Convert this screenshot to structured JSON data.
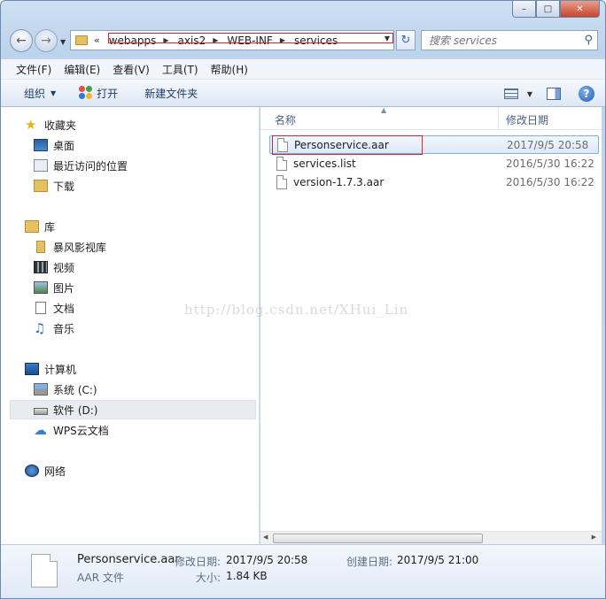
{
  "window": {
    "caption_buttons": {
      "minimize": "–",
      "maximize": "□",
      "close": "✕"
    }
  },
  "navigation": {
    "back_icon": "back-arrow-icon",
    "forward_icon": "forward-arrow-icon",
    "address": {
      "overflow": "«",
      "crumbs": [
        "webapps",
        "axis2",
        "WEB-INF",
        "services"
      ]
    },
    "search_placeholder": "搜索 services"
  },
  "menu": [
    "文件(F)",
    "编辑(E)",
    "查看(V)",
    "工具(T)",
    "帮助(H)"
  ],
  "toolbar": {
    "organize": "组织",
    "open": "打开",
    "new_folder": "新建文件夹",
    "help": "?"
  },
  "sidebar": {
    "favorites": {
      "label": "收藏夹",
      "items": [
        "桌面",
        "最近访问的位置",
        "下载"
      ]
    },
    "libraries": {
      "label": "库",
      "items": [
        "暴风影视库",
        "视频",
        "图片",
        "文档",
        "音乐"
      ]
    },
    "computer": {
      "label": "计算机",
      "items": [
        "系统 (C:)",
        "软件 (D:)",
        "WPS云文档"
      ]
    },
    "network": {
      "label": "网络"
    }
  },
  "columns": {
    "name": "名称",
    "modified": "修改日期"
  },
  "files": [
    {
      "name": "Personservice.aar",
      "modified": "2017/9/5 20:58"
    },
    {
      "name": "services.list",
      "modified": "2016/5/30 16:22"
    },
    {
      "name": "version-1.7.3.aar",
      "modified": "2016/5/30 16:22"
    }
  ],
  "details": {
    "filename": "Personservice.aar",
    "type": "AAR 文件",
    "modified_label": "修改日期:",
    "modified_value": "2017/9/5 20:58",
    "created_label": "创建日期:",
    "created_value": "2017/9/5 21:00",
    "size_label": "大小:",
    "size_value": "1.84 KB"
  },
  "watermark": "http://blog.csdn.net/XHui_Lin",
  "colors": {
    "highlight_box": "#e0202a",
    "selection": "#dce9f8",
    "accent": "#1e5cb3"
  }
}
